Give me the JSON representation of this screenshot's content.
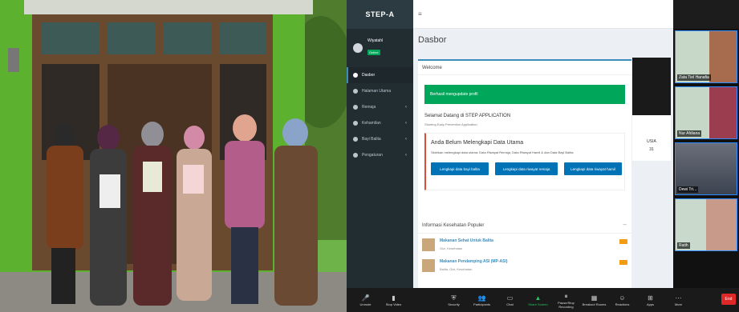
{
  "app": {
    "brand": "STEP-A",
    "user_name": "Wiyatahl",
    "user_status": "Online",
    "menu": [
      {
        "label": "Dasbor",
        "icon": "dashboard-icon",
        "chevron": ""
      },
      {
        "label": "Halaman Utama",
        "icon": "home-icon",
        "chevron": ""
      },
      {
        "label": "Remaja",
        "icon": "user-icon",
        "chevron": "‹"
      },
      {
        "label": "Kehamilan",
        "icon": "heart-icon",
        "chevron": "‹"
      },
      {
        "label": "Bayi Balita",
        "icon": "baby-icon",
        "chevron": "‹"
      },
      {
        "label": "Pengaturan",
        "icon": "gear-icon",
        "chevron": "‹"
      }
    ],
    "page_title": "Dasbor",
    "welcome_header": "Welcome",
    "alert_text": "Berhasil mengupdate profil",
    "greeting": "Selamat Datang di STEP APPLICATION",
    "greeting_sub": "Stunting Early Prevention Application",
    "warning_title": "Anda Belum Melengkapi Data Utama",
    "warning_text": "Silahkan melengkapi data utama: Data Riwayat Remaja, Data Riwayat Hamil & dan Data Bayi Balita",
    "buttons": [
      "Lengkapi data bayi balita",
      "Lengkapi data riwayat remaja",
      "Lengkapi data riwayat hamil"
    ],
    "info_header": "Informasi Kesehatan Populer",
    "news": [
      {
        "title": "Makanan Sehat Untuk Balita",
        "sub": "Gizi, Kesehatan"
      },
      {
        "title": "Makanan Pendamping ASI (MP-ASI)",
        "sub": "Balita, Gizi, Kesehatan"
      }
    ],
    "side_card_label": "USIA",
    "side_card_value": "31"
  },
  "participants": [
    {
      "name": "Zata Tiel Hanafia"
    },
    {
      "name": "Nur Afdiana"
    },
    {
      "name": "Dewi Tri..."
    },
    {
      "name": "Ratih"
    }
  ],
  "toolbar": [
    {
      "label": "Unmute",
      "icon": "mic-icon"
    },
    {
      "label": "Stop Video",
      "icon": "video-icon"
    },
    {
      "label": "Security",
      "icon": "shield-icon"
    },
    {
      "label": "Participants",
      "icon": "people-icon"
    },
    {
      "label": "Chat",
      "icon": "chat-icon"
    },
    {
      "label": "Share Screen",
      "icon": "share-icon"
    },
    {
      "label": "Pause/Stop Recording",
      "icon": "pause-icon"
    },
    {
      "label": "Breakout Rooms",
      "icon": "rooms-icon"
    },
    {
      "label": "Reactions",
      "icon": "smile-icon"
    },
    {
      "label": "Apps",
      "icon": "apps-icon"
    },
    {
      "label": "More",
      "icon": "more-icon"
    }
  ],
  "end_label": "End",
  "colors": {
    "sidebar": "#222d32",
    "accent": "#3c8dbc",
    "alert_green": "#00a65a",
    "button_blue": "#0073b7",
    "zoom_bg": "#1a1a1a",
    "wall_green": "#5aa83a"
  }
}
